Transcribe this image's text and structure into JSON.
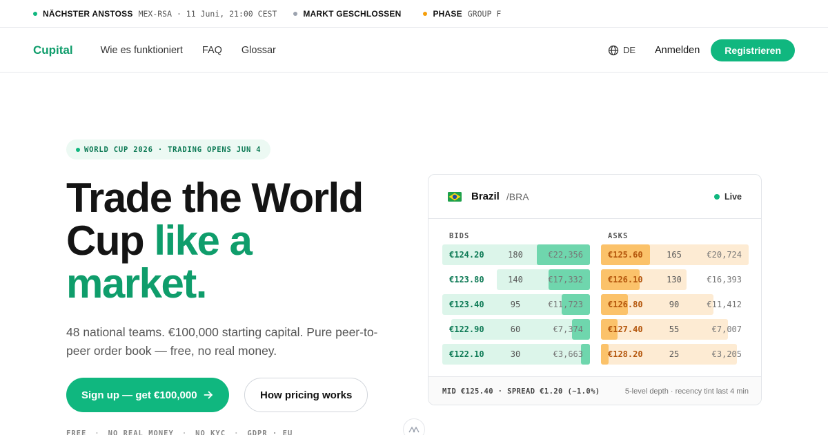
{
  "ticker": [
    {
      "label": "NÄCHSTER ANSTOSS",
      "value": "MEX-RSA · 11 Juni, 21:00 CEST",
      "dot_color": "#10b77f"
    },
    {
      "label": "MARKT GESCHLOSSEN",
      "value": "",
      "dot_color": "#9ca3af"
    },
    {
      "label": "PHASE",
      "value": "GROUP F",
      "dot_color": "#f59e0b"
    }
  ],
  "nav": {
    "logo": "Cupital",
    "links": [
      "Wie es funktioniert",
      "FAQ",
      "Glossar"
    ],
    "language": "DE",
    "signin": "Anmelden",
    "register": "Registrieren"
  },
  "hero": {
    "badge": "WORLD CUP 2026 · TRADING OPENS JUN 4",
    "title_line1": "Trade the World",
    "title_line2_plain": "Cup ",
    "title_line2_accent": "like a",
    "title_line3_accent": "market.",
    "subtitle": "48 national teams. €100,000 starting capital. Pure peer-to-peer order book — free, no real money.",
    "primary_cta": "Sign up — get €100,000",
    "secondary_cta": "How pricing works",
    "features": [
      "FREE",
      "NO REAL MONEY",
      "NO KYC",
      "GDPR · EU"
    ]
  },
  "orderbook": {
    "team": "Brazil",
    "code": "/BRA",
    "status": "Live",
    "bids_label": "BIDS",
    "asks_label": "ASKS",
    "bids": [
      {
        "price": "€124.20",
        "size": "180",
        "total": "€22,356",
        "depth_pct": 100,
        "recency_pct": 36
      },
      {
        "price": "€123.80",
        "size": "140",
        "total": "€17,332",
        "depth_pct": 63,
        "recency_pct": 28
      },
      {
        "price": "€123.40",
        "size": "95",
        "total": "€11,723",
        "depth_pct": 100,
        "recency_pct": 19
      },
      {
        "price": "€122.90",
        "size": "60",
        "total": "€7,374",
        "depth_pct": 94,
        "recency_pct": 12
      },
      {
        "price": "€122.10",
        "size": "30",
        "total": "€3,663",
        "depth_pct": 100,
        "recency_pct": 6
      }
    ],
    "asks": [
      {
        "price": "€125.60",
        "size": "165",
        "total": "€20,724",
        "depth_pct": 100,
        "recency_pct": 33
      },
      {
        "price": "€126.10",
        "size": "130",
        "total": "€16,393",
        "depth_pct": 58,
        "recency_pct": 26
      },
      {
        "price": "€126.80",
        "size": "90",
        "total": "€11,412",
        "depth_pct": 76,
        "recency_pct": 18
      },
      {
        "price": "€127.40",
        "size": "55",
        "total": "€7,007",
        "depth_pct": 86,
        "recency_pct": 11
      },
      {
        "price": "€128.20",
        "size": "25",
        "total": "€3,205",
        "depth_pct": 92,
        "recency_pct": 5
      }
    ],
    "mid_spread": "MID €125.40 · SPREAD €1.20 (~1.0%)",
    "depth_note": "5-level depth · recency tint last 4 min"
  },
  "colors": {
    "accent": "#10b77f",
    "accent_dark": "#0f9d6b",
    "bid_bg": "#dcf5ea",
    "bid_hl": "#6fd6ad",
    "bid_text": "#0d7a55",
    "ask_bg": "#fdebd3",
    "ask_hl": "#fbc26a",
    "ask_text": "#b4560c"
  }
}
